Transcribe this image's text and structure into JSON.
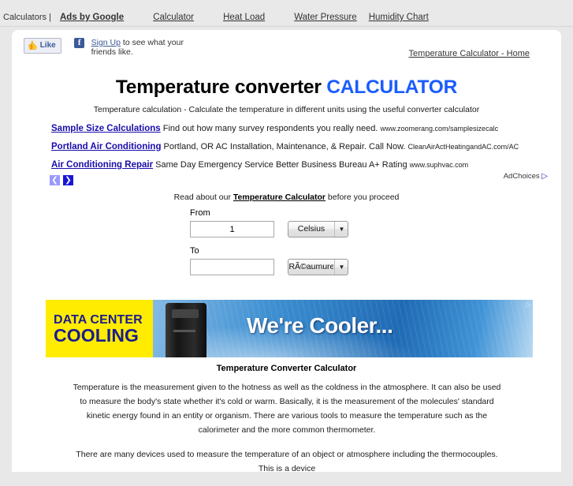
{
  "topnav": {
    "prefix": "Calculators |",
    "brand": "Ads by Google",
    "links": [
      {
        "label": "Calculator"
      },
      {
        "label": "Heat Load"
      },
      {
        "label": "Water Pressure"
      },
      {
        "label": "Humidity Chart"
      }
    ]
  },
  "social": {
    "like_label": "Like",
    "thumb_icon": "thumbs-up-icon",
    "fb_icon": "facebook-icon",
    "signup_label": "Sign Up",
    "signup_rest": " to see what your friends like."
  },
  "home_link": "Temperature Calculator - Home",
  "header": {
    "title_black": "Temperature converter ",
    "title_blue": "CALCULATOR",
    "subtitle": "Temperature calculation - Calculate the temperature in different units using the useful converter calculator"
  },
  "text_ads": [
    {
      "title": "Sample Size Calculations",
      "desc": " Find out how many survey respondents you really need. ",
      "url": "www.zoomerang.com/samplesizecalc"
    },
    {
      "title": "Portland Air Conditioning",
      "desc": " Portland, OR AC Installation, Maintenance, & Repair. Call Now. ",
      "url": "CleanAirActHeatingandAC.com/AC"
    },
    {
      "title": "Air Conditioning Repair",
      "desc": " Same Day Emergency Service Better Business Bureau A+ Rating ",
      "url": "www.suphvac.com"
    }
  ],
  "ad_nav": {
    "prev": "❮",
    "next": "❯"
  },
  "adchoices": {
    "label": "AdChoices",
    "glyph": "▷"
  },
  "read_about": {
    "before": "Read about our ",
    "link": "Temperature Calculator",
    "after": " before you proceed"
  },
  "converter": {
    "from_label": "From",
    "from_value": "1",
    "from_unit": "Celsius",
    "to_label": "To",
    "to_value": "",
    "to_unit": "RÃ©aumure",
    "dropdown_arrow": "▼"
  },
  "banner": {
    "line1": "DATA CENTER",
    "line2": "COOLING",
    "headline": "We're Cooler...",
    "choices_glyph": "▷"
  },
  "article": {
    "title": "Temperature Converter Calculator",
    "paragraphs": [
      "Temperature is the measurement given to the hotness as well as the coldness in the atmosphere. It can also be used to measure the body's state whether it's cold or warm. Basically, it is the measurement of the molecules' standard kinetic energy found in an entity or organism. There are various tools to measure the temperature such as the calorimeter and the more common thermometer.",
      "There are many devices used to measure the temperature of an object or atmosphere including the thermocouples. This is a device"
    ]
  },
  "colors": {
    "accent_blue": "#1a5cff",
    "ad_link": "#1a0dab",
    "page_bg": "#e8e8e8",
    "card_bg": "#ffffff",
    "banner_yellow": "#ffec00",
    "banner_navy": "#1b1b8f"
  }
}
